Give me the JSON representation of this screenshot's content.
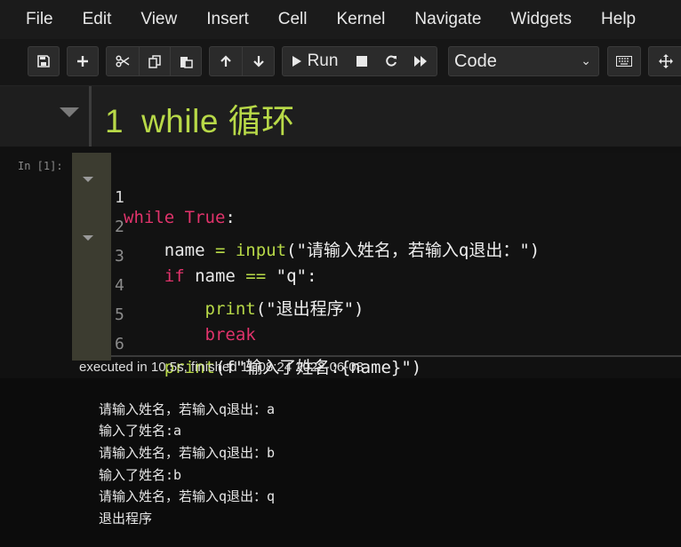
{
  "menu": [
    "File",
    "Edit",
    "View",
    "Insert",
    "Cell",
    "Kernel",
    "Navigate",
    "Widgets",
    "Help"
  ],
  "toolbar": {
    "icons": [
      "save-icon",
      "plus-icon",
      "cut-icon",
      "copy-icon",
      "paste-icon",
      "arrow-up-icon",
      "arrow-down-icon",
      "play-icon",
      "stop-icon",
      "restart-icon",
      "fast-forward-icon",
      "keyboard-icon",
      "move-icon"
    ],
    "run_label": "Run",
    "cell_type": "Code"
  },
  "markdown_cell": {
    "number": "1",
    "heading": "while 循环"
  },
  "code_cell": {
    "prompt": "In [1]:",
    "line_numbers": [
      "1",
      "2",
      "3",
      "4",
      "5",
      "6"
    ],
    "lines": [
      [
        "while",
        " ",
        "True",
        ":"
      ],
      [
        "    name",
        " = ",
        "input",
        "(\"请输入姓名，若输入q退出：\")"
      ],
      [
        "    ",
        "if",
        " name ",
        "==",
        " \"q\":"
      ],
      [
        "        ",
        "print",
        "(\"退出程序\")"
      ],
      [
        "        ",
        "break"
      ],
      [
        "    ",
        "print",
        "(f\"输入了姓名:{name}\")"
      ]
    ],
    "exec_info": "executed in 10.5s, finished 11:08:24 2022-06-08"
  },
  "output": [
    "请输入姓名，若输入q退出：a",
    "输入了姓名:a",
    "请输入姓名，若输入q退出：b",
    "输入了姓名:b",
    "请输入姓名，若输入q退出：q",
    "退出程序"
  ],
  "colors": {
    "keyword": "#e0336b",
    "builtin": "#b8d948",
    "heading": "#b8d948",
    "background": "#111111"
  }
}
